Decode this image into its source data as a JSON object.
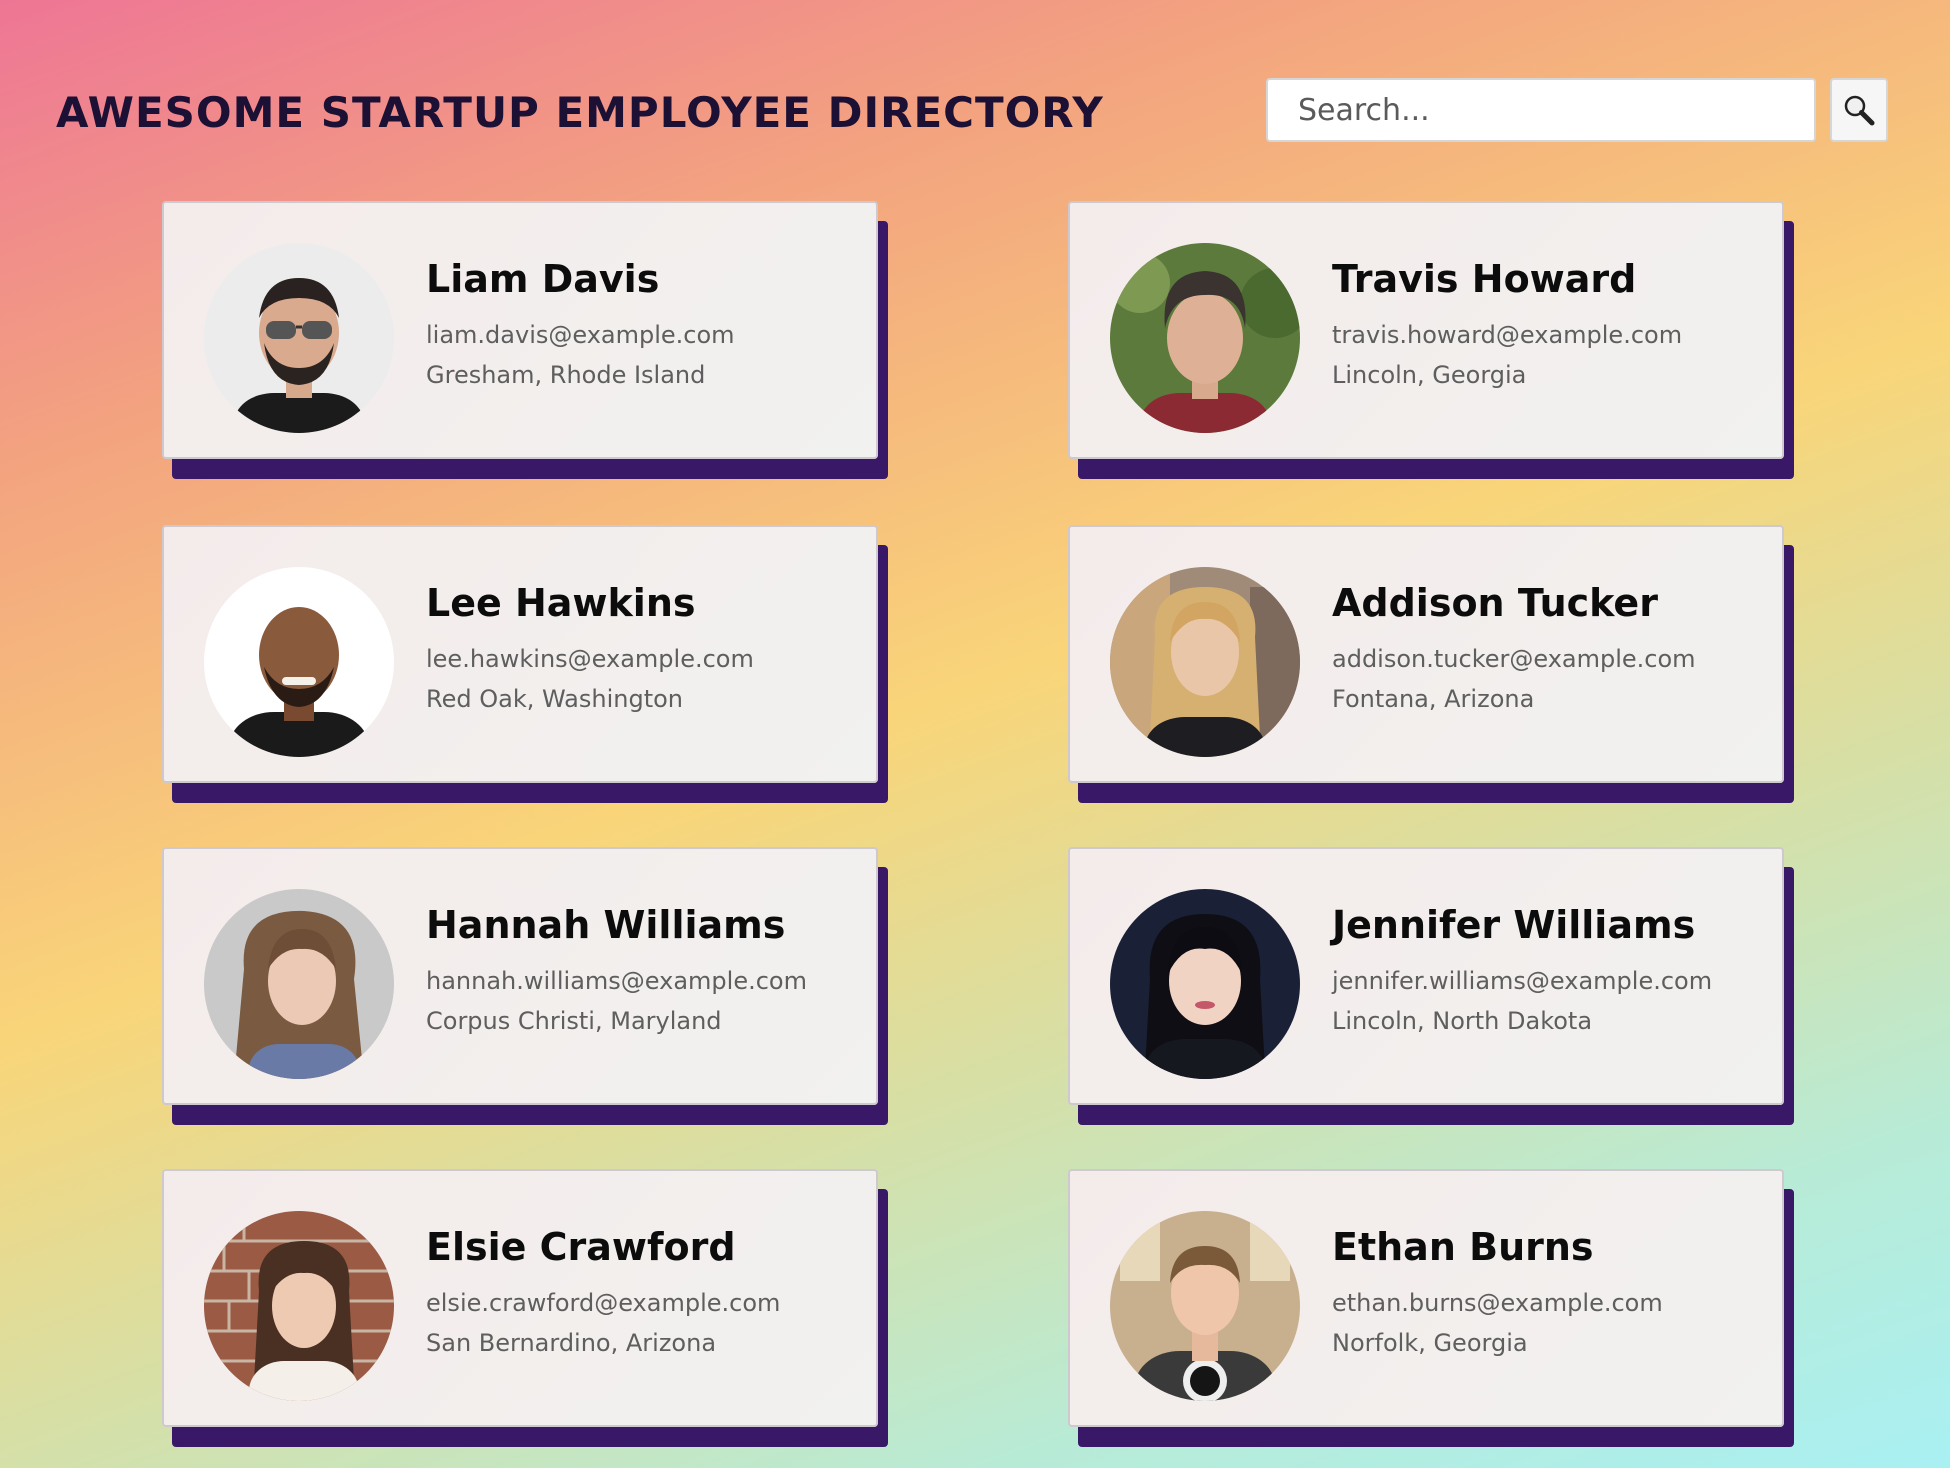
{
  "header": {
    "title": "AWESOME STARTUP EMPLOYEE DIRECTORY",
    "search_placeholder": "Search...",
    "search_icon": "magnifying-glass-icon"
  },
  "colors": {
    "card_shadow": "#3a1868",
    "title": "#1c1135",
    "name": "#0c0c0c",
    "detail_text": "#5e5e5e"
  },
  "employees": [
    {
      "name": "Liam Davis",
      "email": "liam.davis@example.com",
      "location": "Gresham, Rhode Island"
    },
    {
      "name": "Travis Howard",
      "email": "travis.howard@example.com",
      "location": "Lincoln, Georgia"
    },
    {
      "name": "Lee Hawkins",
      "email": "lee.hawkins@example.com",
      "location": "Red Oak, Washington"
    },
    {
      "name": "Addison Tucker",
      "email": "addison.tucker@example.com",
      "location": "Fontana, Arizona"
    },
    {
      "name": "Hannah Williams",
      "email": "hannah.williams@example.com",
      "location": "Corpus Christi, Maryland"
    },
    {
      "name": "Jennifer Williams",
      "email": "jennifer.williams@example.com",
      "location": "Lincoln, North Dakota"
    },
    {
      "name": "Elsie Crawford",
      "email": "elsie.crawford@example.com",
      "location": "San Bernardino, Arizona"
    },
    {
      "name": "Ethan Burns",
      "email": "ethan.burns@example.com",
      "location": "Norfolk, Georgia"
    }
  ]
}
